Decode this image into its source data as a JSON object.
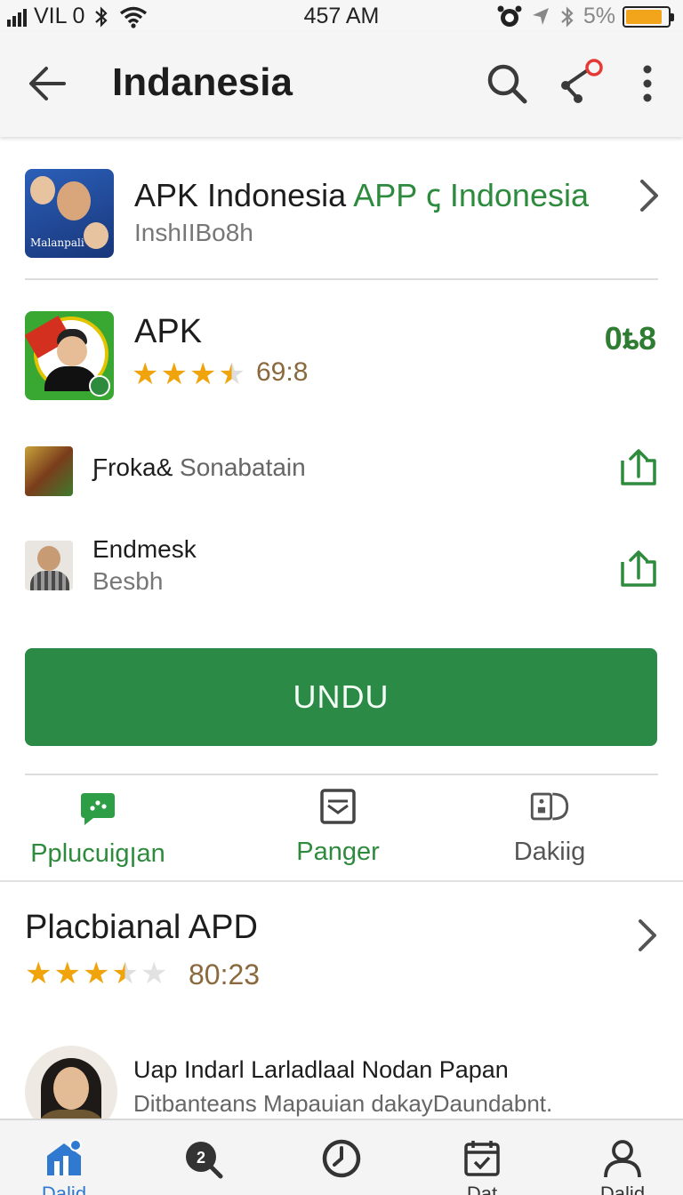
{
  "status_bar": {
    "carrier": "VIL 0",
    "time": "457 AM",
    "battery": "5%",
    "battery_color": "#f2a41a"
  },
  "app_bar": {
    "title": "Indanesia",
    "icons": [
      "back-arrow-icon",
      "search-icon",
      "share-icon",
      "more-vert-icon"
    ],
    "notify_color": "#e53935"
  },
  "featured": {
    "name": "APK Indonesia",
    "name_highlight": "APP ꞔ Indonesia",
    "subtitle": "InshIIBo8h",
    "thumb_caption": "Malanpali"
  },
  "app": {
    "name": "APK",
    "rating": "69:8",
    "stars": 3.5,
    "price": "0ȶ8"
  },
  "related": [
    {
      "title": "Ƒroka&",
      "title_gray": "Sonabatain",
      "subtitle": ""
    },
    {
      "title": "Endmesk",
      "title_gray": "",
      "subtitle": "Besbh"
    }
  ],
  "primary_button": {
    "label": "UNDU",
    "color": "#2b8a45"
  },
  "tabs": [
    {
      "label": "Pplucuigꞁan",
      "icon": "chat-bubble-icon",
      "color": "#2e8b3e"
    },
    {
      "label": "Panger",
      "icon": "inbox-icon",
      "color": "#2e8b3e"
    },
    {
      "label": "Dakiig",
      "icon": "device-icon",
      "color": "#555555"
    }
  ],
  "section": {
    "title": "Placbianal APD",
    "rating": "80:23",
    "stars": 3.5
  },
  "review": {
    "line1": "Uap Indarl Larladlaal Nodan Papan",
    "line2": "Ditbanteans Mapauian dakayDaundabnt."
  },
  "bottom_nav": [
    {
      "icon": "home-chart-icon",
      "label": "Dalid",
      "color": "#2f7ad0"
    },
    {
      "icon": "search-q-icon",
      "label": "",
      "color": "#333333"
    },
    {
      "icon": "clock-icon",
      "label": "",
      "color": "#333333"
    },
    {
      "icon": "calendar-icon",
      "label": "Dat",
      "color": "#333333"
    },
    {
      "icon": "profile-icon",
      "label": "Dalid",
      "color": "#333333"
    }
  ]
}
